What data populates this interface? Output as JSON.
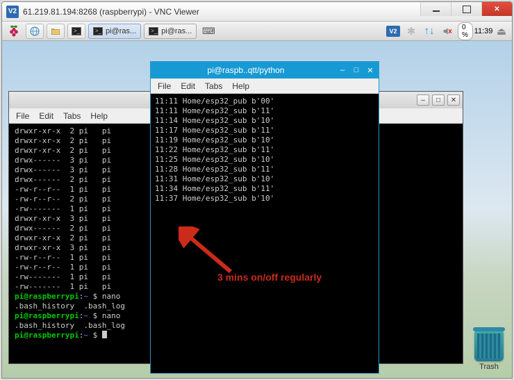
{
  "outer_title": "61.219.81.194:8268 (raspberrypi) - VNC Viewer",
  "taskbar": {
    "task1_label": "pi@ras...",
    "task2_label": "pi@ras...",
    "cpu_pct": "0 %",
    "clock": "11:39"
  },
  "back_terminal": {
    "menu": {
      "file": "File",
      "edit": "Edit",
      "tabs": "Tabs",
      "help": "Help"
    },
    "lines": [
      "drwxr-xr-x  2 pi   pi",
      "drwxr-xr-x  2 pi   pi",
      "drwxr-xr-x  2 pi   pi",
      "drwx------  3 pi   pi",
      "drwx------  3 pi   pi",
      "drwx------  2 pi   pi",
      "-rw-r--r--  1 pi   pi",
      "-rw-r--r--  2 pi   pi",
      "-rw-------  1 pi   pi",
      "drwxr-xr-x  3 pi   pi",
      "drwx------  2 pi   pi",
      "drwxr-xr-x  2 pi   pi",
      "drwxr-xr-x  3 pi   pi",
      "-rw-r--r--  1 pi   pi",
      "-rw-r--r--  1 pi   pi",
      "-rw-------  1 pi   pi",
      "-rw-------  1 pi   pi"
    ],
    "prompt_user": "pi@raspberrypi",
    "prompt_path": "~",
    "cmd_nano": "nano",
    "history_row": ".bash_history  .bash_log"
  },
  "front_terminal": {
    "title": "pi@raspb..qtt/python",
    "menu": {
      "file": "File",
      "edit": "Edit",
      "tabs": "Tabs",
      "help": "Help"
    },
    "log": [
      "11:11 Home/esp32_pub b'00'",
      "11:11 Home/esp32_sub b'11'",
      "11:14 Home/esp32_sub b'10'",
      "11:17 Home/esp32_sub b'11'",
      "11:19 Home/esp32_sub b'10'",
      "11:22 Home/esp32_sub b'11'",
      "11:25 Home/esp32_sub b'10'",
      "11:28 Home/esp32_sub b'11'",
      "11:31 Home/esp32_sub b'10'",
      "11:34 Home/esp32_sub b'11'",
      "11:37 Home/esp32_sub b'10'"
    ]
  },
  "annotation_text": "3 mins on/off regularly",
  "trash_label": "Trash"
}
